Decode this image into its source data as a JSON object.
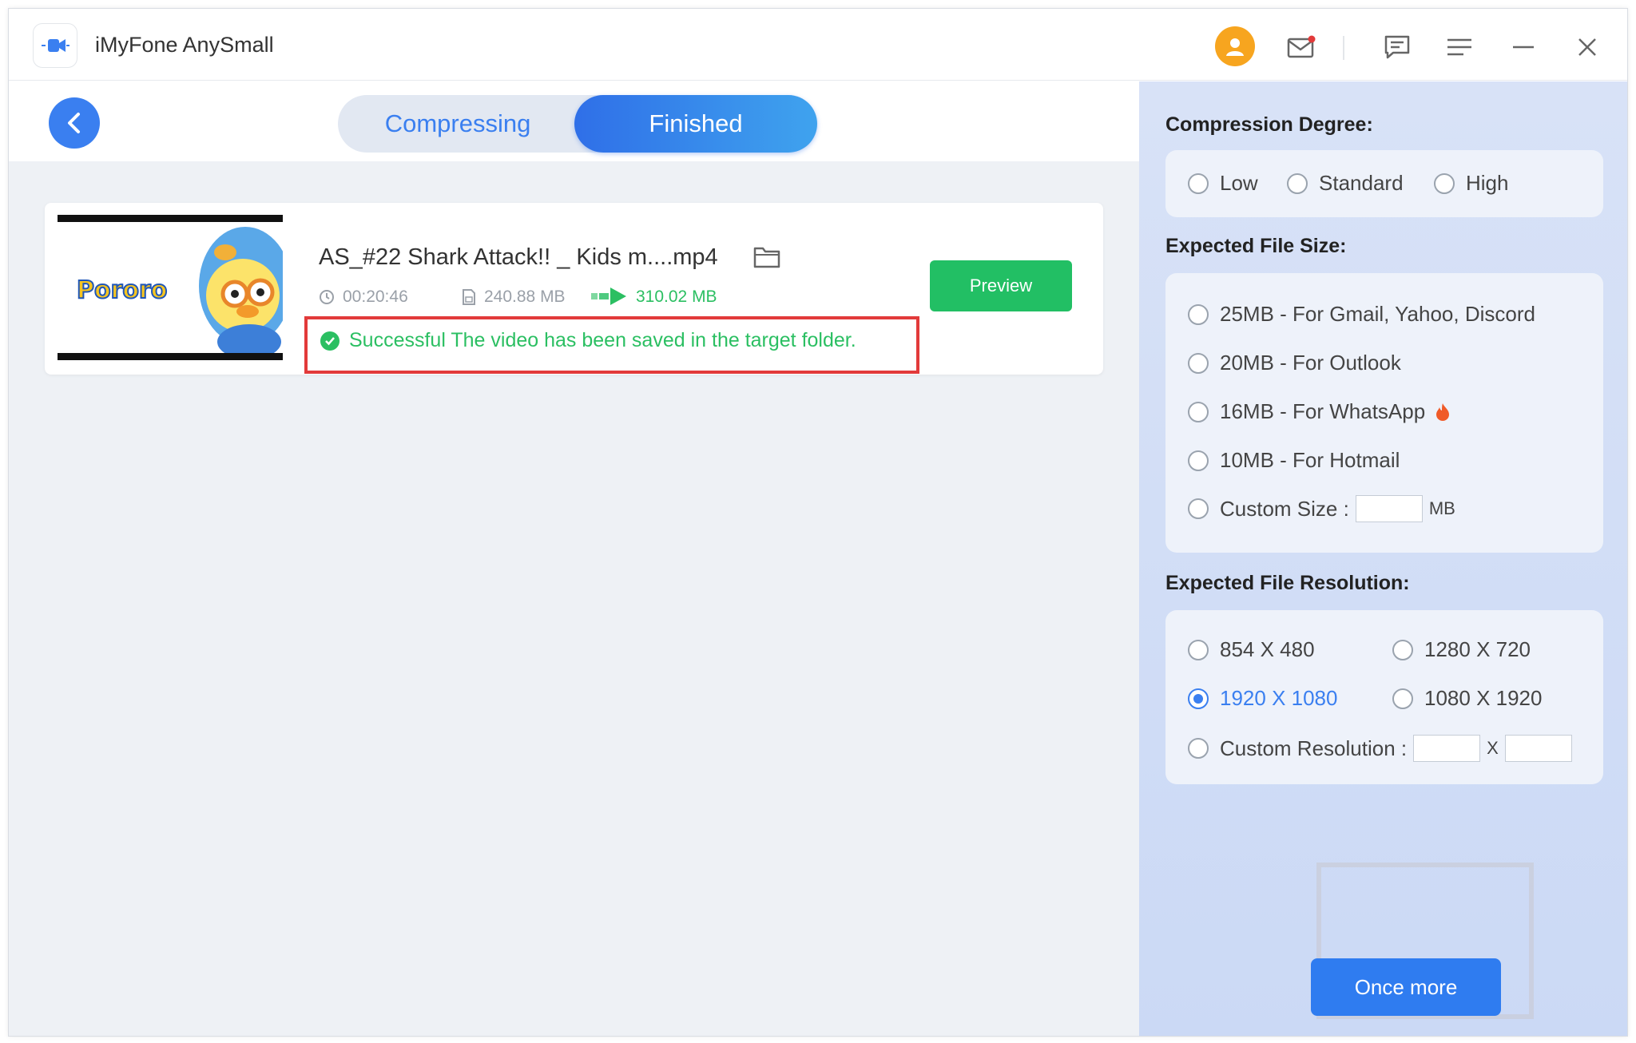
{
  "app": {
    "title": "iMyFone AnySmall"
  },
  "tabs": [
    {
      "label": "Compressing",
      "active": false
    },
    {
      "label": "Finished",
      "active": true
    }
  ],
  "file": {
    "name": "AS_#22 Shark Attack!! _ Kids m....mp4",
    "duration": "00:20:46",
    "original_size": "240.88 MB",
    "compressed_size": "310.02 MB",
    "status_message": "Successful The video has been saved in the target folder.",
    "thumbnail_text": "Pororo",
    "preview_label": "Preview"
  },
  "settings": {
    "degree": {
      "title": "Compression Degree:",
      "options": [
        "Low",
        "Standard",
        "High"
      ],
      "selected": null
    },
    "size": {
      "title": "Expected File Size:",
      "options": [
        "25MB - For Gmail, Yahoo, Discord",
        "20MB - For Outlook",
        "16MB - For WhatsApp",
        "10MB - For Hotmail",
        "Custom Size :"
      ],
      "custom_unit": "MB"
    },
    "resolution": {
      "title": "Expected File Resolution:",
      "options": [
        "854 X 480",
        "1280 X 720",
        "1920 X 1080",
        "1080 X 1920",
        "Custom Resolution :"
      ],
      "selected": "1920 X 1080",
      "separator": "X"
    },
    "once_more_label": "Once more"
  },
  "colors": {
    "accent": "#3a7ff0",
    "success": "#2bbf62",
    "highlight_box": "#e23a3a",
    "avatar": "#f7a51f"
  },
  "icons": {
    "titlebar": [
      "user-avatar-icon",
      "mail-icon",
      "feedback-icon",
      "menu-icon",
      "minimize-icon",
      "close-icon"
    ]
  }
}
